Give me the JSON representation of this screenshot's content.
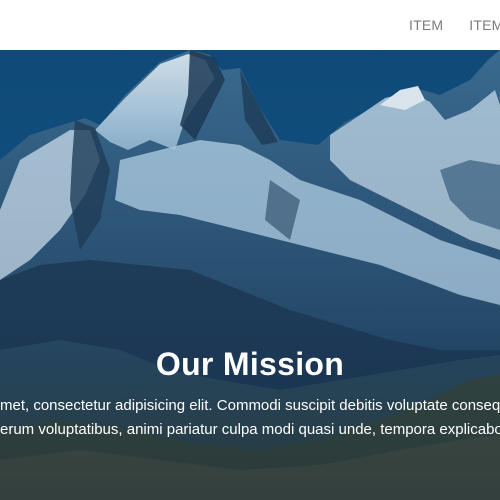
{
  "navbar": {
    "items": [
      {
        "label": "ITEM"
      },
      {
        "label": "ITEM"
      }
    ]
  },
  "hero": {
    "title": "Our Mission",
    "lines": [
      "met, consectetur adipisicing elit. Commodi suscipit debitis voluptate conseq",
      "erum voluptatibus, animi pariatur culpa modi quasi unde, tempora explicabo"
    ]
  },
  "colors": {
    "sky": "#13507c",
    "nav_text": "#7b7b7b",
    "hero_text": "#ffffff"
  }
}
